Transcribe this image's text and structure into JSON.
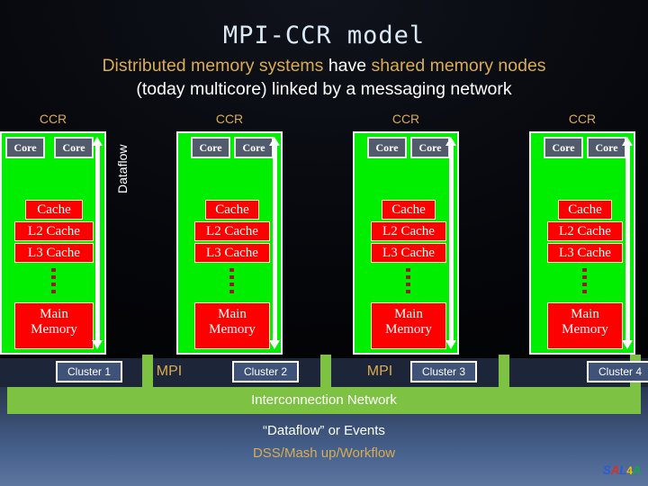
{
  "title": "MPI-CCR model",
  "subtitle": {
    "line1_part1": "Distributed memory systems ",
    "line1_part2": "have",
    "line1_part3": " shared memory nodes",
    "line2": "(today multicore) linked by a messaging network"
  },
  "clusters": [
    {
      "ccr_label": "CCR",
      "cores": [
        "Core",
        "Core"
      ],
      "caches": [
        "Cache",
        "L2 Cache",
        "L3 Cache"
      ],
      "memory_line1": "Main",
      "memory_line2": "Memory",
      "footer_label": "Cluster 1"
    },
    {
      "ccr_label": "CCR",
      "cores": [
        "Core",
        "Core"
      ],
      "caches": [
        "Cache",
        "L2 Cache",
        "L3 Cache"
      ],
      "memory_line1": "Main",
      "memory_line2": "Memory",
      "footer_label": "Cluster 2"
    },
    {
      "ccr_label": "CCR",
      "cores": [
        "Core",
        "Core"
      ],
      "caches": [
        "Cache",
        "L2 Cache",
        "L3 Cache"
      ],
      "memory_line1": "Main",
      "memory_line2": "Memory",
      "footer_label": "Cluster 3"
    },
    {
      "ccr_label": "CCR",
      "cores": [
        "Core",
        "Core"
      ],
      "caches": [
        "Cache",
        "L2 Cache",
        "L3 Cache"
      ],
      "memory_line1": "Main",
      "memory_line2": "Memory",
      "footer_label": "Cluster 4"
    }
  ],
  "dataflow_label": "Dataflow",
  "mpi_labels": [
    "MPI",
    "MPI"
  ],
  "interconnect_label": "Interconnection Network",
  "footer": {
    "line1": "“Dataflow” or Events",
    "line2": "DSS/Mash up/Workflow"
  },
  "logo": {
    "part1": "S",
    "part2": "A",
    "part3": "L",
    "part4": "4",
    "part5": "A"
  },
  "colors": {
    "cluster_green": "#00ef00",
    "band_green": "#7dc242",
    "cache_red": "#fe0000",
    "gold": "#d9ab52",
    "core_slate": "#515b6b",
    "navy": "#1d2638"
  }
}
